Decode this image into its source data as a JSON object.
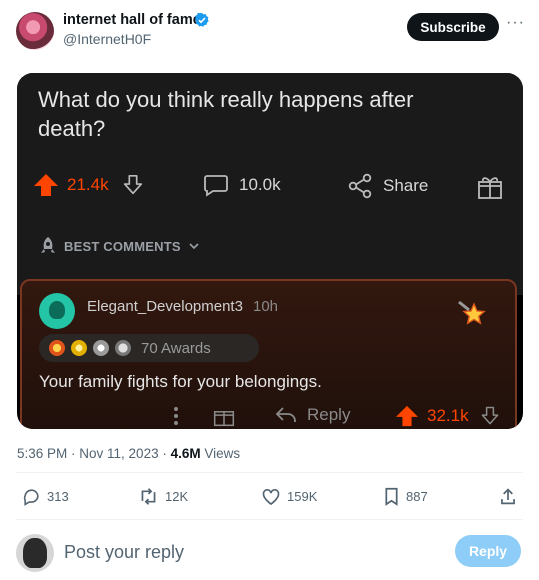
{
  "author": {
    "display_name": "internet hall of fame",
    "handle": "@InternetH0F"
  },
  "header": {
    "subscribe_label": "Subscribe",
    "more_label": "···"
  },
  "embed": {
    "question": "What do you think really happens after death?",
    "post_actions": {
      "upvotes": "21.4k",
      "comments": "10.0k",
      "share_label": "Share"
    },
    "best_comments_label": "BEST COMMENTS",
    "comment": {
      "username": "Elegant_Development3",
      "age": "10h",
      "awards_label": "70 Awards",
      "text": "Your family fights for your belongings.",
      "reply_label": "Reply",
      "upvotes": "32.1k"
    },
    "colors": {
      "upvote": "#ff4500",
      "background": "#1a1a1b",
      "comment_border": "#7a3620"
    }
  },
  "meta": {
    "time": "5:36 PM · Nov 11, 2023 · ",
    "views_count": "4.6M",
    "views_label": " Views"
  },
  "engagement": {
    "replies": "313",
    "reposts": "12K",
    "likes": "159K",
    "bookmarks": "887"
  },
  "reply": {
    "placeholder": "Post your reply",
    "button_label": "Reply"
  },
  "colors": {
    "accent": "#1d9bf0",
    "reply_button_disabled": "#8ecdf8",
    "secondary_text": "#536471"
  }
}
